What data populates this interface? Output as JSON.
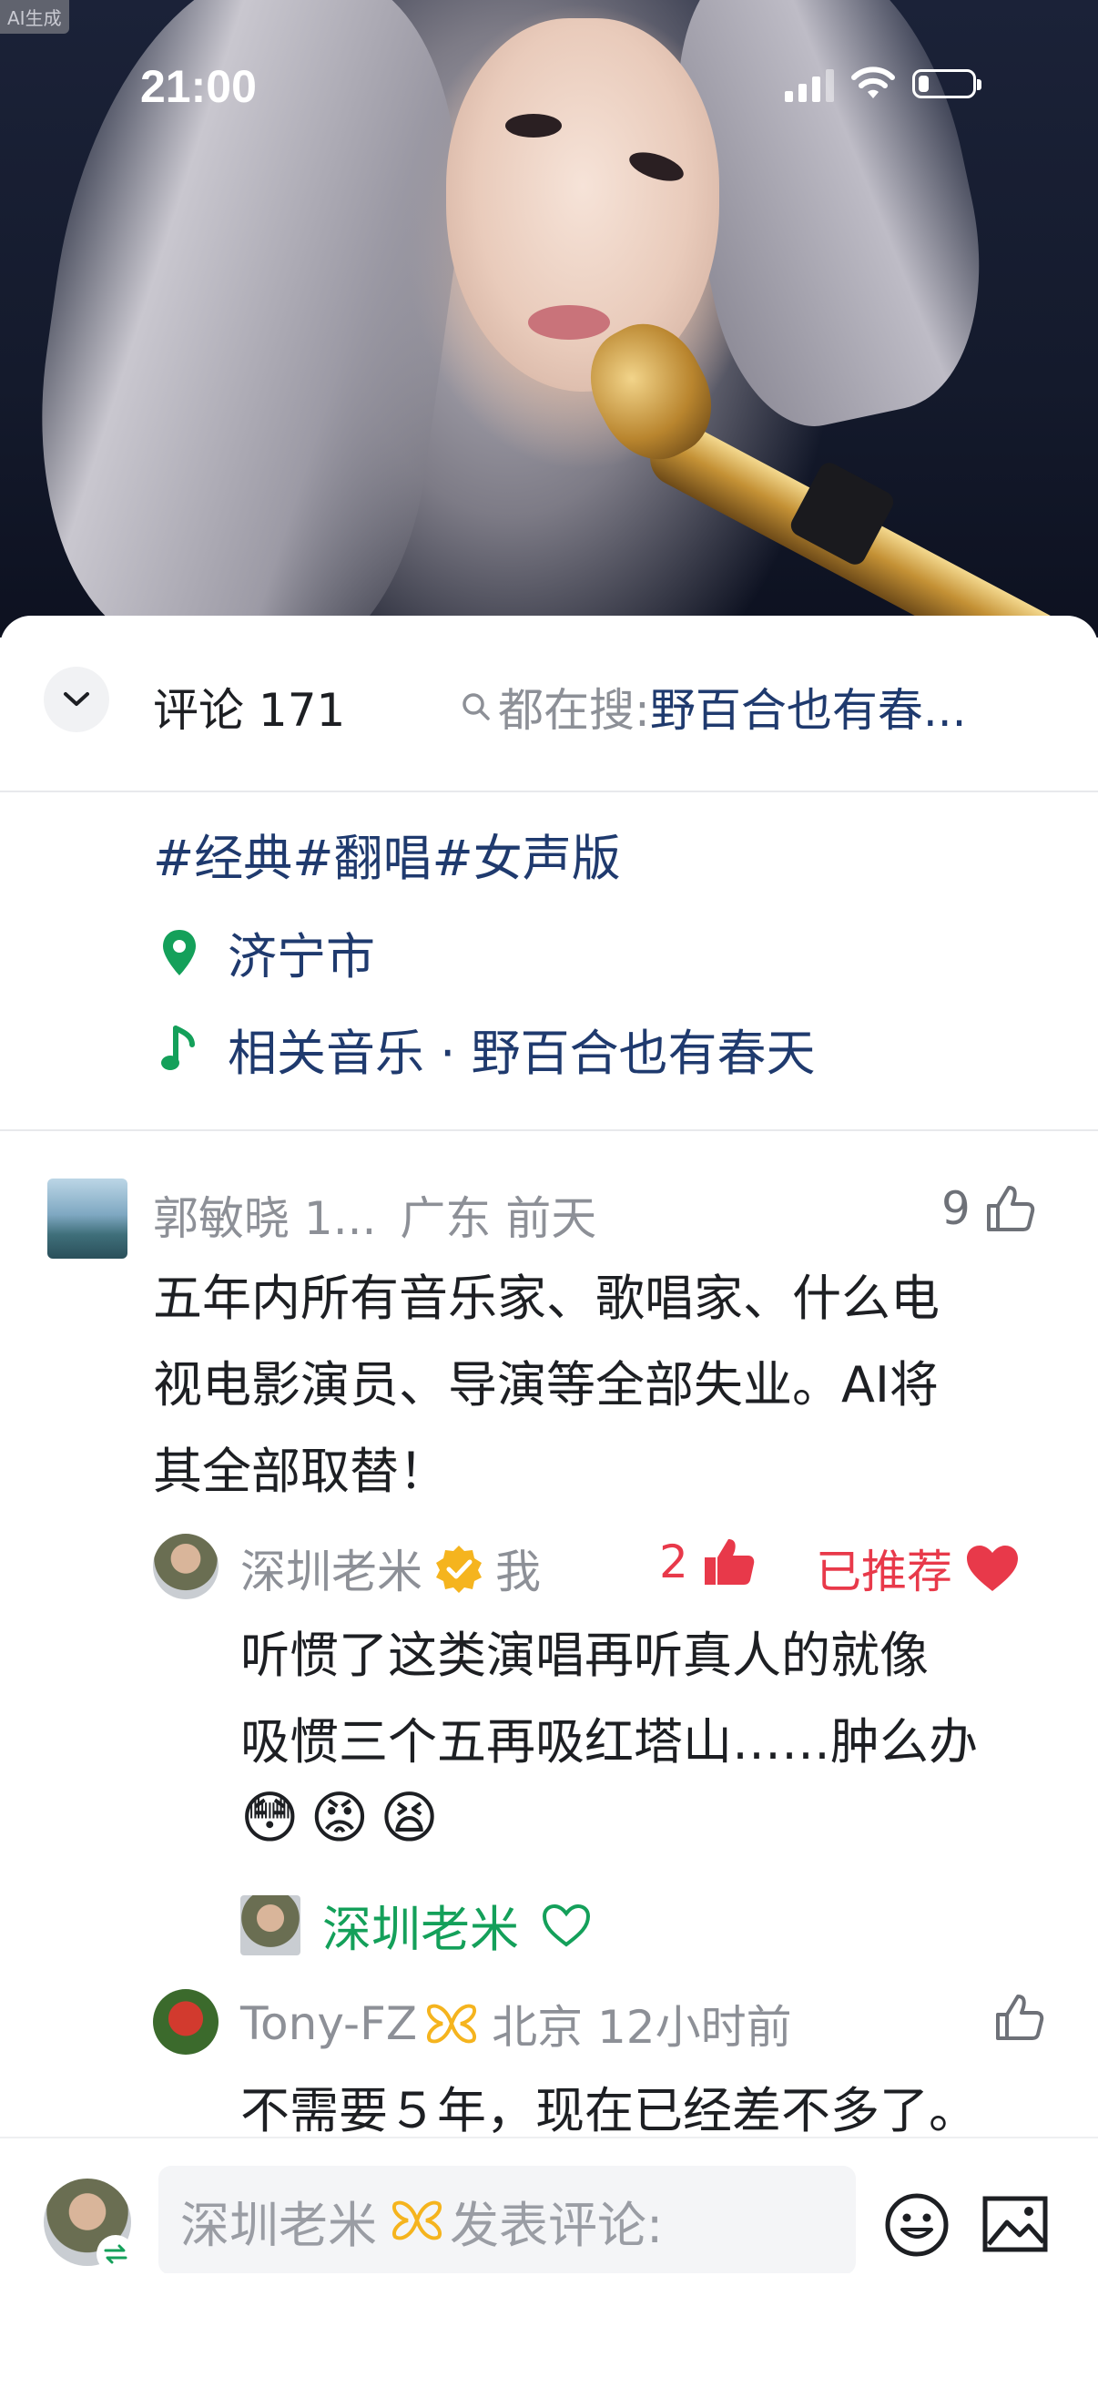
{
  "status_bar": {
    "time": "21:00",
    "battery_level": 0.2
  },
  "hero": {
    "ai_tag": "AI生成"
  },
  "comments_header": {
    "title": "评论 171",
    "search_prefix": "都在搜: ",
    "search_keyword": "野百合也有春..."
  },
  "post": {
    "tags": "#经典#翻唱#女声版",
    "location": "济宁市",
    "music": "相关音乐 · 野百合也有春天"
  },
  "comments": [
    {
      "author": "郭敏晓 1...",
      "region_time": "广东  前天",
      "likes": "9",
      "text_lines": [
        "五年内所有音乐家、歌唱家、什么电",
        "视电影演员、导演等全部失业。AI将",
        "其全部取替！"
      ],
      "reply": {
        "author": "深圳老米",
        "self_tag": "我",
        "likes": "2",
        "recommended": "已推荐",
        "text_lines": [
          "听惯了这类演唱再听真人的就像",
          "吸惯三个五再吸红塔山……肿么办"
        ],
        "emojis": [
          "😳",
          "😡",
          "😫"
        ],
        "liked_by": "深圳老米"
      }
    },
    {
      "author": "Tony-FZ",
      "region_time": "北京  12小时前",
      "likes": "",
      "text_lines": [
        "不需要５年，现在已经差不多了。"
      ]
    }
  ],
  "input_bar": {
    "user_name": "深圳老米",
    "placeholder": " 发表评论:"
  },
  "colors": {
    "link": "#1f3a6e",
    "red": "#e8394a",
    "green": "#14a05a",
    "gold": "#f5b41e"
  }
}
